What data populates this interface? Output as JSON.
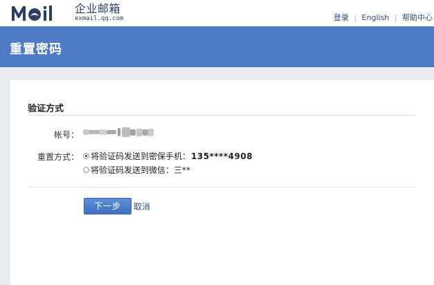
{
  "brand": {
    "logo_text": "Moil",
    "name_cn": "企业邮箱",
    "domain": "exmail.qq.com",
    "color": "#2b3f66"
  },
  "toplinks": {
    "login": "登录",
    "english": "English",
    "help": "帮助中心",
    "separator": "|"
  },
  "header": {
    "title": "重置密码",
    "color": "#4e7bc4"
  },
  "section": {
    "title": "验证方式"
  },
  "account": {
    "label": "帐号："
  },
  "reset": {
    "label": "重置方式：",
    "options": [
      {
        "text": "将验证码发送到密保手机：",
        "value": "135****4908",
        "checked": true
      },
      {
        "text": "将验证码发送到微信：",
        "value": "三**",
        "checked": false
      }
    ]
  },
  "actions": {
    "next": "下一步",
    "cancel": "取消"
  }
}
